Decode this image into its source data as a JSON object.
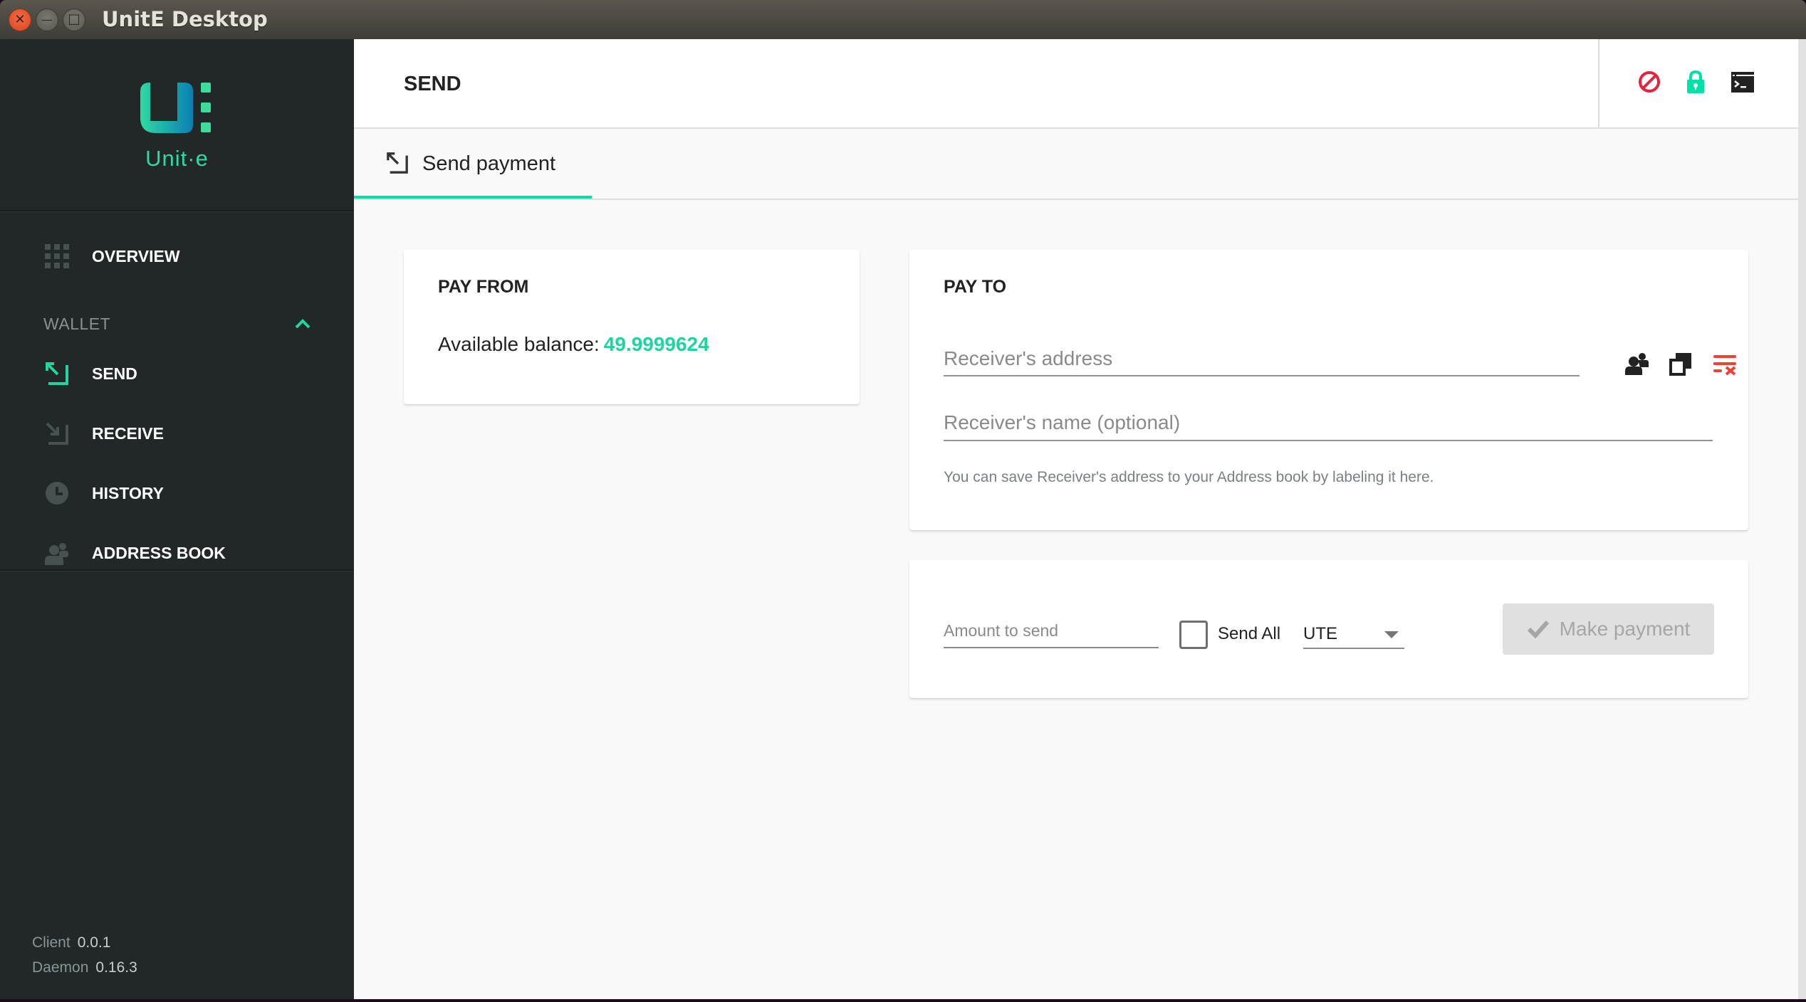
{
  "window": {
    "title": "UnitE Desktop",
    "close_glyph": "✕",
    "minimize_glyph": "—",
    "maximize_glyph": "☐"
  },
  "sidebar": {
    "logo_text": "Unit·e",
    "overview_label": "OVERVIEW",
    "wallet_section_label": "WALLET",
    "wallet_expanded": true,
    "items": [
      {
        "label": "SEND",
        "icon": "send-arrow-icon",
        "active": true
      },
      {
        "label": "RECEIVE",
        "icon": "receive-arrow-icon",
        "active": false
      },
      {
        "label": "HISTORY",
        "icon": "clock-icon",
        "active": false
      },
      {
        "label": "ADDRESS BOOK",
        "icon": "contacts-icon",
        "active": false
      }
    ],
    "versions": {
      "client_label": "Client",
      "client_value": "0.0.1",
      "daemon_label": "Daemon",
      "daemon_value": "0.16.3"
    }
  },
  "header": {
    "title": "SEND",
    "icons": [
      "no-connection-icon",
      "lock-icon",
      "console-icon"
    ]
  },
  "tabs": [
    {
      "label": "Send payment",
      "active": true
    }
  ],
  "pay_from": {
    "title": "PAY FROM",
    "balance_label": "Available balance:",
    "balance_value": "49.9999624"
  },
  "pay_to": {
    "title": "PAY TO",
    "address_placeholder": "Receiver's address",
    "address_value": "",
    "name_placeholder": "Receiver's name (optional)",
    "name_value": "",
    "hint": "You can save Receiver's address to your Address book by labeling it here."
  },
  "amount": {
    "placeholder": "Amount to send",
    "value": "",
    "send_all_label": "Send All",
    "send_all_checked": false,
    "currency": "UTE",
    "make_payment_label": "Make payment",
    "make_payment_enabled": false
  },
  "colors": {
    "accent": "#00e1a8",
    "balance": "#1ed4a0",
    "danger": "#e5233f",
    "sidebar_bg": "#222728"
  }
}
